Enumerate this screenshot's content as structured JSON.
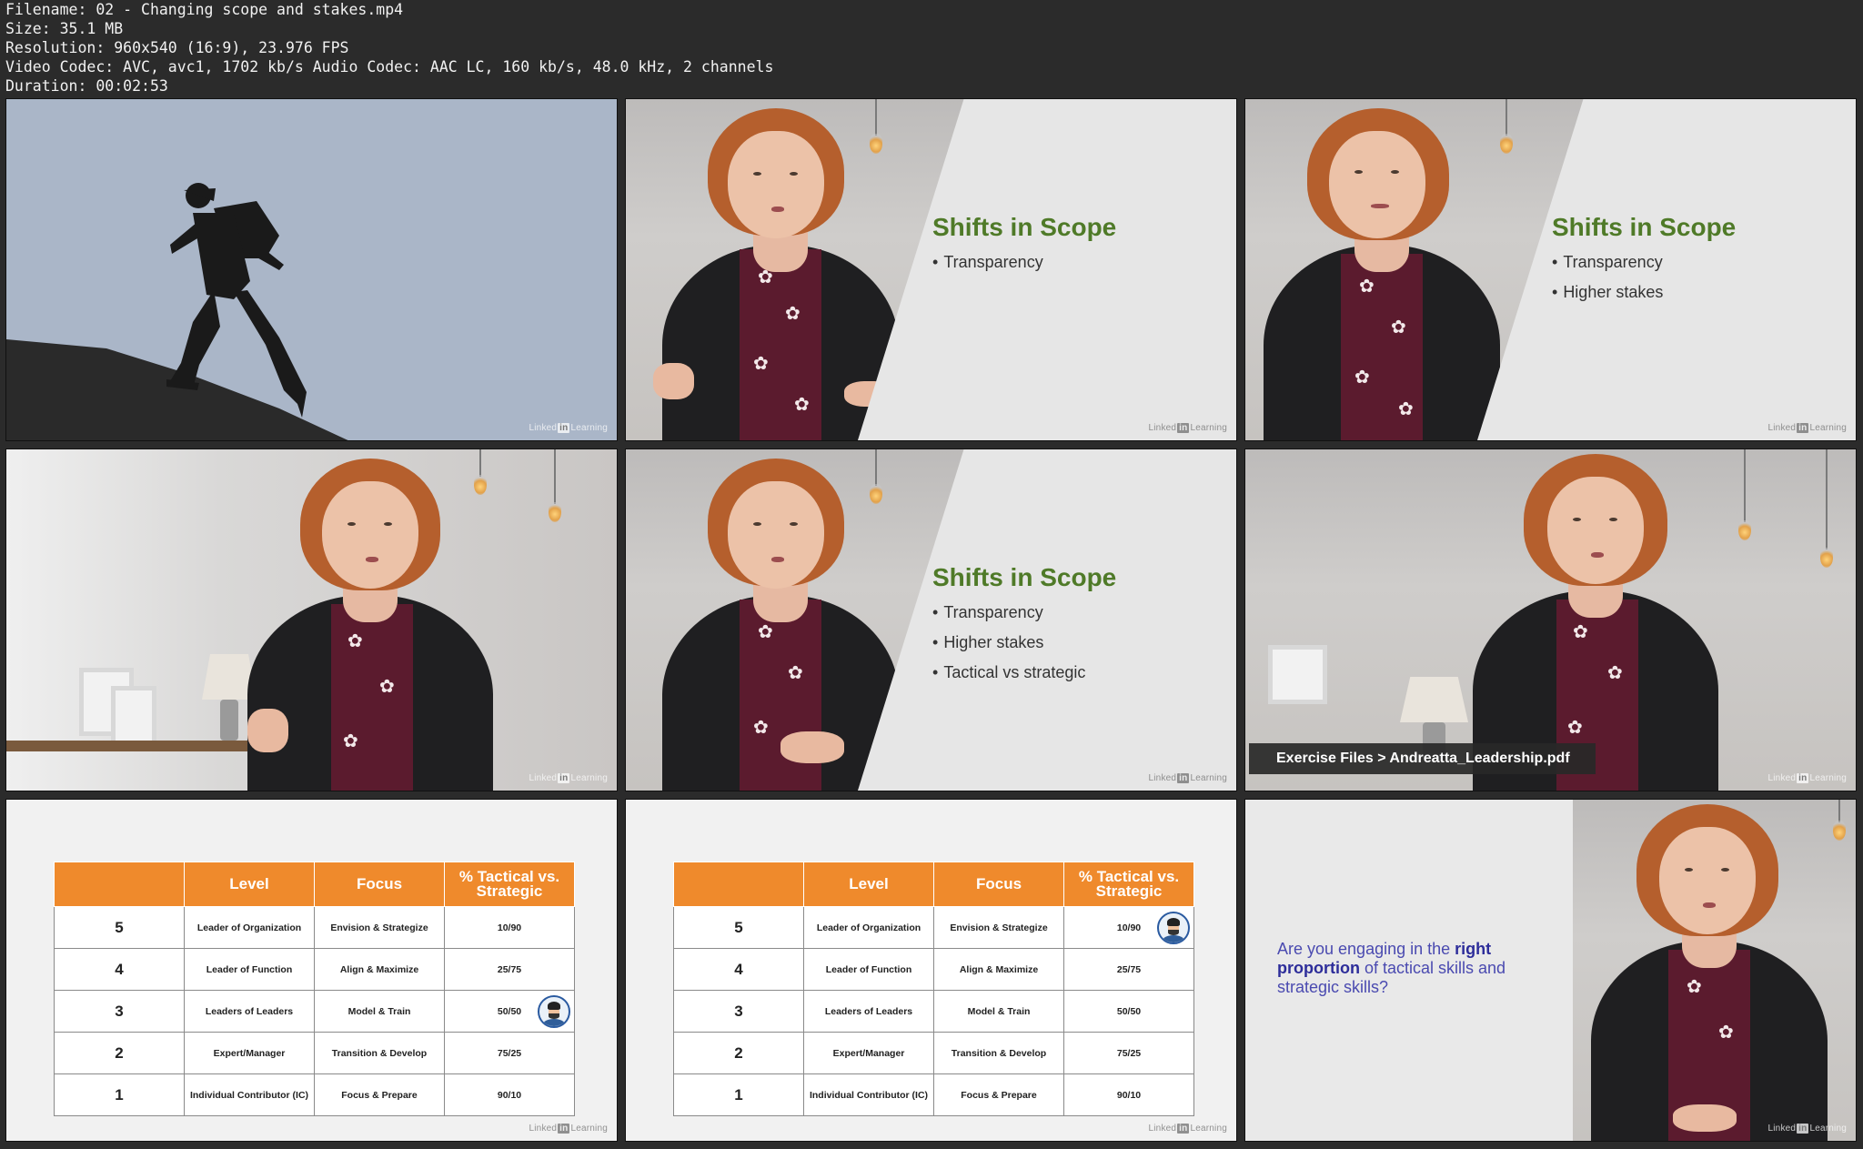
{
  "file_info": {
    "filename": "Filename: 02 - Changing scope and stakes.mp4",
    "size": "Size: 35.1 MB",
    "resolution": "Resolution: 960x540 (16:9), 23.976 FPS",
    "codec": "Video Codec: AVC, avc1, 1702 kb/s Audio Codec: AAC LC, 160 kb/s, 48.0 kHz, 2 channels",
    "duration": "Duration: 00:02:53"
  },
  "watermark": {
    "left": "Linked",
    "in": "in",
    "right": "Learning"
  },
  "slides": {
    "title": "Shifts in Scope",
    "bullets": [
      "Transparency",
      "Higher stakes",
      "Tactical vs strategic"
    ]
  },
  "caption": "Exercise Files > Andreatta_Leadership.pdf",
  "table": {
    "headers": [
      "",
      "Level",
      "Focus",
      "% Tactical vs. Strategic"
    ],
    "rows": [
      {
        "num": "5",
        "level": "Leader of Organization",
        "focus": "Envision & Strategize",
        "ratio": "10/90"
      },
      {
        "num": "4",
        "level": "Leader of Function",
        "focus": "Align & Maximize",
        "ratio": "25/75"
      },
      {
        "num": "3",
        "level": "Leaders of Leaders",
        "focus": "Model & Train",
        "ratio": "50/50"
      },
      {
        "num": "2",
        "level": "Expert/Manager",
        "focus": "Transition & Develop",
        "ratio": "75/25"
      },
      {
        "num": "1",
        "level": "Individual Contributor (IC)",
        "focus": "Focus & Prepare",
        "ratio": "90/10"
      }
    ]
  },
  "question": {
    "part1": "Are you engaging in the ",
    "bold": "right proportion",
    "part2": " of tactical skills and strategic skills?"
  },
  "colors": {
    "title_green": "#4f7a28",
    "table_orange": "#ef8a2c",
    "question_blue": "#4a4ab0"
  }
}
